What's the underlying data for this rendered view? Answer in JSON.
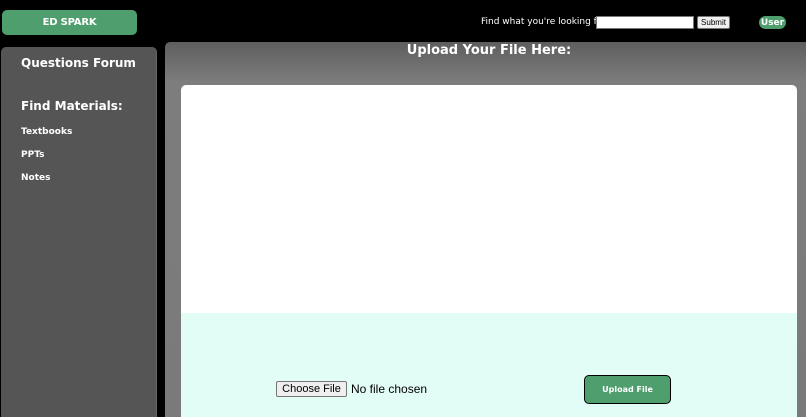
{
  "header": {
    "logo": "ED SPARK",
    "search_label": "Find what you're looking for",
    "search_value": "",
    "submit_label": "Submit",
    "user_label": "User"
  },
  "sidebar": {
    "forum_label": "Questions Forum",
    "materials_heading": "Find Materials:",
    "materials": [
      {
        "label": "Textbooks"
      },
      {
        "label": "PPTs"
      },
      {
        "label": "Notes"
      }
    ]
  },
  "main": {
    "title": "Upload Your File Here:",
    "choose_file_label": "Choose File",
    "no_file_text": "No file chosen",
    "upload_label": "Upload File"
  },
  "colors": {
    "accent": "#4f9e6e",
    "drop_area": "#e2fcf6",
    "sidebar": "#555555"
  }
}
